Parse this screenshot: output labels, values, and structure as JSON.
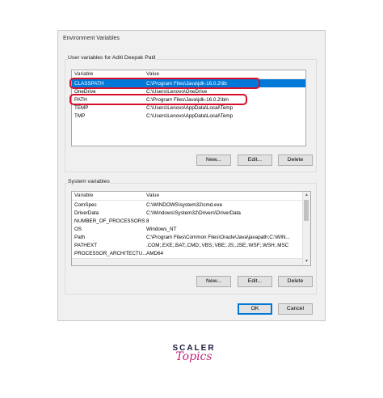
{
  "dialog": {
    "title": "Environment Variables"
  },
  "user_vars": {
    "group_label": "User variables for Aditi Deepak Patil",
    "columns": [
      "Variable",
      "Value"
    ],
    "rows": [
      {
        "variable": "CLASSPATH",
        "value": "C:\\Program Files\\Java\\jdk-16.0.2\\lib",
        "selected": true
      },
      {
        "variable": "OneDrive",
        "value": "C:\\Users\\Lenovo\\OneDrive",
        "selected": false
      },
      {
        "variable": "PATH",
        "value": "C:\\Program Files\\Java\\jdk-16.0.2\\bin",
        "selected": false
      },
      {
        "variable": "TEMP",
        "value": "C:\\Users\\Lenovo\\AppData\\Local\\Temp",
        "selected": false
      },
      {
        "variable": "TMP",
        "value": "C:\\Users\\Lenovo\\AppData\\Local\\Temp",
        "selected": false
      }
    ],
    "buttons": {
      "new": "New...",
      "edit": "Edit...",
      "delete": "Delete"
    }
  },
  "system_vars": {
    "group_label": "System variables",
    "columns": [
      "Variable",
      "Value"
    ],
    "rows": [
      {
        "variable": "ComSpec",
        "value": "C:\\WINDOWS\\system32\\cmd.exe"
      },
      {
        "variable": "DriverData",
        "value": "C:\\Windows\\System32\\Drivers\\DriverData"
      },
      {
        "variable": "NUMBER_OF_PROCESSORS",
        "value": "8"
      },
      {
        "variable": "OS",
        "value": "Windows_NT"
      },
      {
        "variable": "Path",
        "value": "C:\\Program Files\\Common Files\\Oracle\\Java\\javapath;C:\\WIN..."
      },
      {
        "variable": "PATHEXT",
        "value": ".COM;.EXE;.BAT;.CMD;.VBS;.VBE;.JS;.JSE;.WSF;.WSH;.MSC"
      },
      {
        "variable": "PROCESSOR_ARCHITECTU...",
        "value": "AMD64"
      }
    ],
    "buttons": {
      "new": "New...",
      "edit": "Edit...",
      "delete": "Delete"
    }
  },
  "footer": {
    "ok": "OK",
    "cancel": "Cancel"
  },
  "logo": {
    "line1": "SCALER",
    "line2": "Topics"
  },
  "colors": {
    "selection": "#0078d7",
    "highlight_outline": "#d6102a",
    "logo_pink": "#c2247a"
  }
}
